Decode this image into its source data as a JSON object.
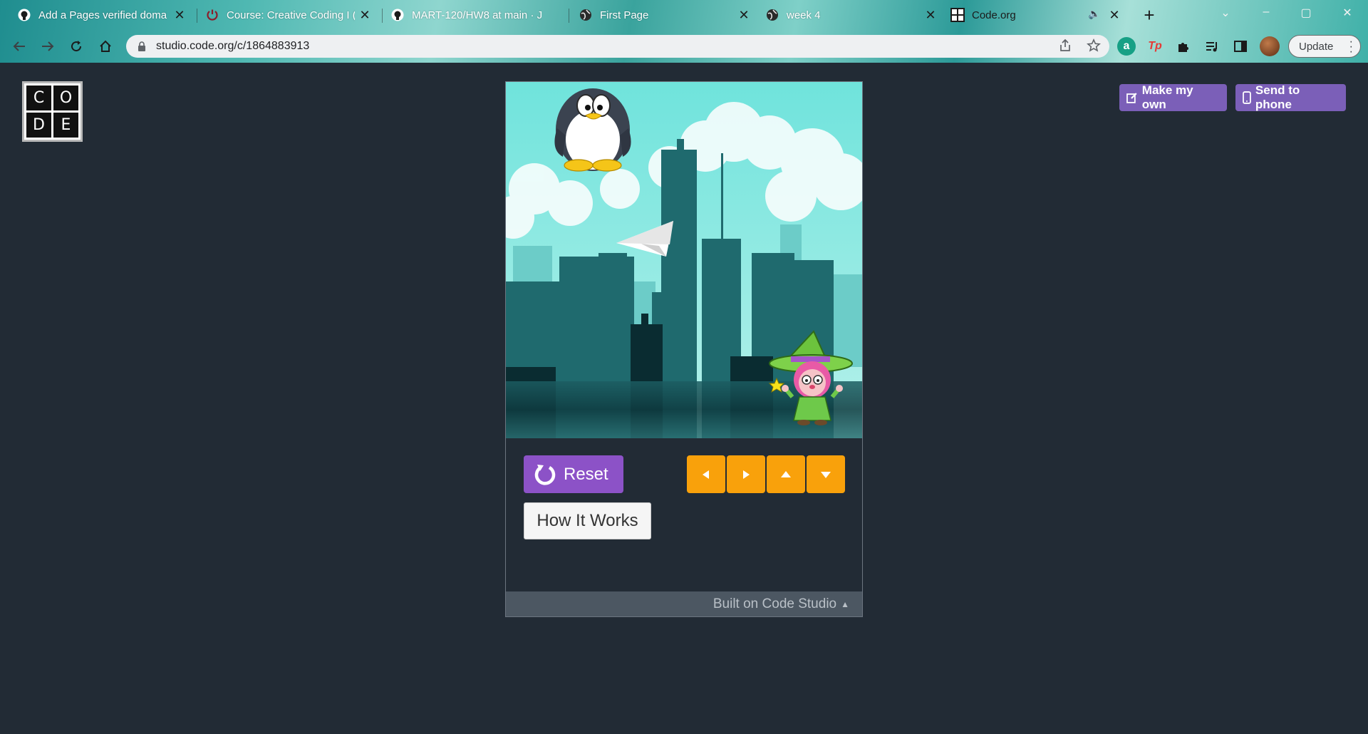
{
  "browser": {
    "tabs": [
      {
        "title": "Add a Pages verified domai",
        "icon": "github-icon"
      },
      {
        "title": "Course: Creative Coding I (S",
        "icon": "power-icon"
      },
      {
        "title": "MART-120/HW8 at main · J",
        "icon": "github-icon"
      },
      {
        "title": "First Page",
        "icon": "globe-icon"
      },
      {
        "title": "week 4",
        "icon": "globe-icon"
      },
      {
        "title": "Code.org",
        "icon": "codeorg-icon"
      }
    ],
    "new_tab": "+",
    "url": "studio.code.org/c/1864883913",
    "update_label": "Update",
    "extensions": [
      "a",
      "Tp"
    ]
  },
  "logo": {
    "letters": [
      "C",
      "O",
      "D",
      "E"
    ]
  },
  "actions": {
    "make_my_own": "Make my own",
    "send_to_phone": "Send to phone"
  },
  "controls": {
    "reset_label": "Reset",
    "how_it_works_label": "How It Works",
    "arrows": [
      "left",
      "right",
      "up",
      "down"
    ]
  },
  "footer": {
    "text": "Built on Code Studio",
    "caret": "▲"
  },
  "colors": {
    "page_bg": "#222b35",
    "reset_purple": "#8c52c7",
    "arrow_orange": "#f9a10b",
    "top_button_purple": "#7b5fb8",
    "sky": "#7ee0da",
    "city_dark": "#1f6a6e"
  }
}
